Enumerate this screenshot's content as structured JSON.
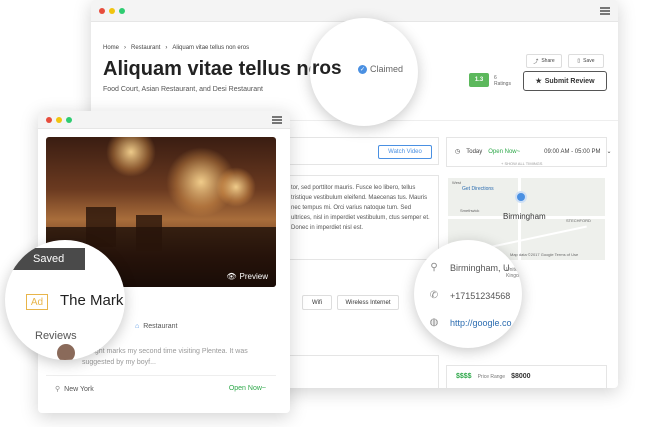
{
  "back": {
    "breadcrumb": [
      "Home",
      "Restaurant",
      "Aliquam vitae tellus non eros"
    ],
    "title": "Aliquam vitae tellus non",
    "categories": "Food Court, Asian Restaurant, and Desi Restaurant",
    "share_label": "Share",
    "save_label": "Save",
    "rating": "1.3",
    "ratings_label": "Ratings",
    "ratings_count": "6",
    "submit_review": "Submit Review",
    "watch_video": "Watch Video",
    "lorem": "tor, sed porttitor mauris. Fusce leo libero, tellus tristique vestibulum eleifend. Maecenas tus. Mauris nec tempus mi. Orci varius natoque tum. Sed ultrices, nisl in imperdiet vestibulum, ctus semper et. Donec in imperdiet nisl est.",
    "tags": [
      "Wifi",
      "Wireless Internet"
    ],
    "today_label": "Today",
    "open_status": "Open Now~",
    "hours": "09:00 AM - 05:00 PM",
    "show_all": "+ SHOW ALL TIMINGS",
    "map_city": "Birmingham",
    "map_labels": [
      "West",
      "Smethwick",
      "STECHFORD"
    ],
    "map_directions": "Get Directions",
    "map_footer": "Map data ©2017 Google   Terms of Use",
    "price_symbols": "$$$$",
    "price_label": "Price Range",
    "price_value": "$8000"
  },
  "front": {
    "preview_label": "Preview",
    "category": "Restaurant",
    "review_text": "Tonight marks my second time visiting Plentea. It was suggested by my boyf...",
    "location": "New York",
    "open_status": "Open Now~"
  },
  "mag1": {
    "title_fragment": "ros",
    "claimed": "Claimed"
  },
  "mag2": {
    "saved": "Saved",
    "ad": "Ad",
    "name": "The Mark Hotel",
    "reviews": "Reviews"
  },
  "mag3": {
    "address": "Birmingham, U",
    "address_sub": "United Kingdom",
    "phone": "+17151234568",
    "website": "http://google.co"
  }
}
